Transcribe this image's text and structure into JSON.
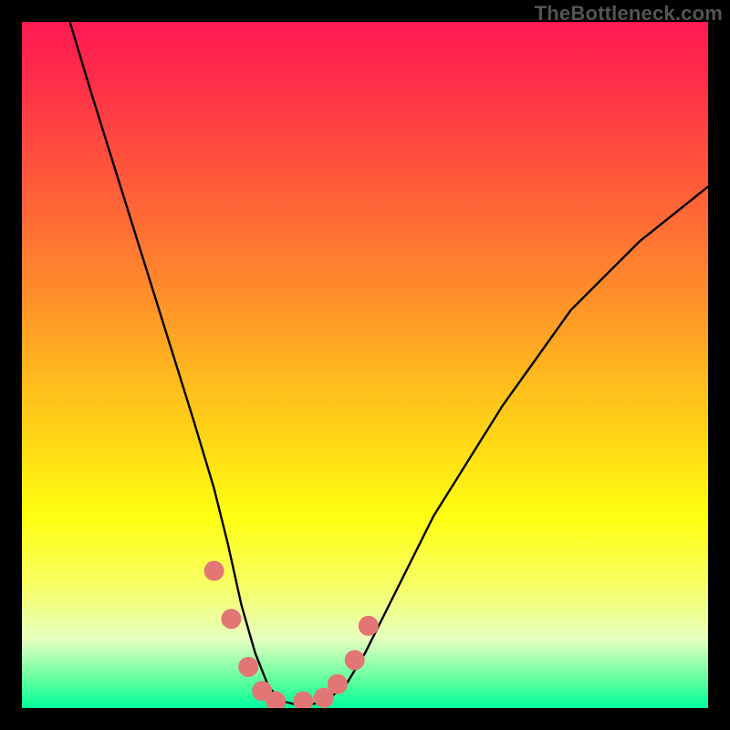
{
  "watermark": "TheBottleneck.com",
  "chart_data": {
    "type": "line",
    "title": "",
    "xlabel": "",
    "ylabel": "",
    "xlim": [
      0,
      100
    ],
    "ylim": [
      0,
      100
    ],
    "series": [
      {
        "name": "curve",
        "x": [
          7,
          10,
          15,
          20,
          25,
          28,
          30,
          32,
          34,
          36,
          38,
          40,
          42,
          44,
          47,
          50,
          55,
          60,
          65,
          70,
          75,
          80,
          85,
          90,
          95,
          100
        ],
        "y": [
          100,
          90,
          74,
          58,
          42,
          32,
          24,
          15,
          8,
          3,
          1,
          0.5,
          0.5,
          1,
          3,
          8,
          18,
          28,
          36,
          44,
          51,
          58,
          63,
          68,
          72,
          76
        ]
      }
    ],
    "markers": {
      "name": "highlight",
      "color": "#e27674",
      "x": [
        28,
        30.5,
        33,
        35,
        37,
        41,
        44,
        46,
        48.5,
        50.5
      ],
      "y": [
        20,
        13,
        6,
        2.5,
        1,
        1,
        1.5,
        3.5,
        7,
        12
      ]
    }
  }
}
